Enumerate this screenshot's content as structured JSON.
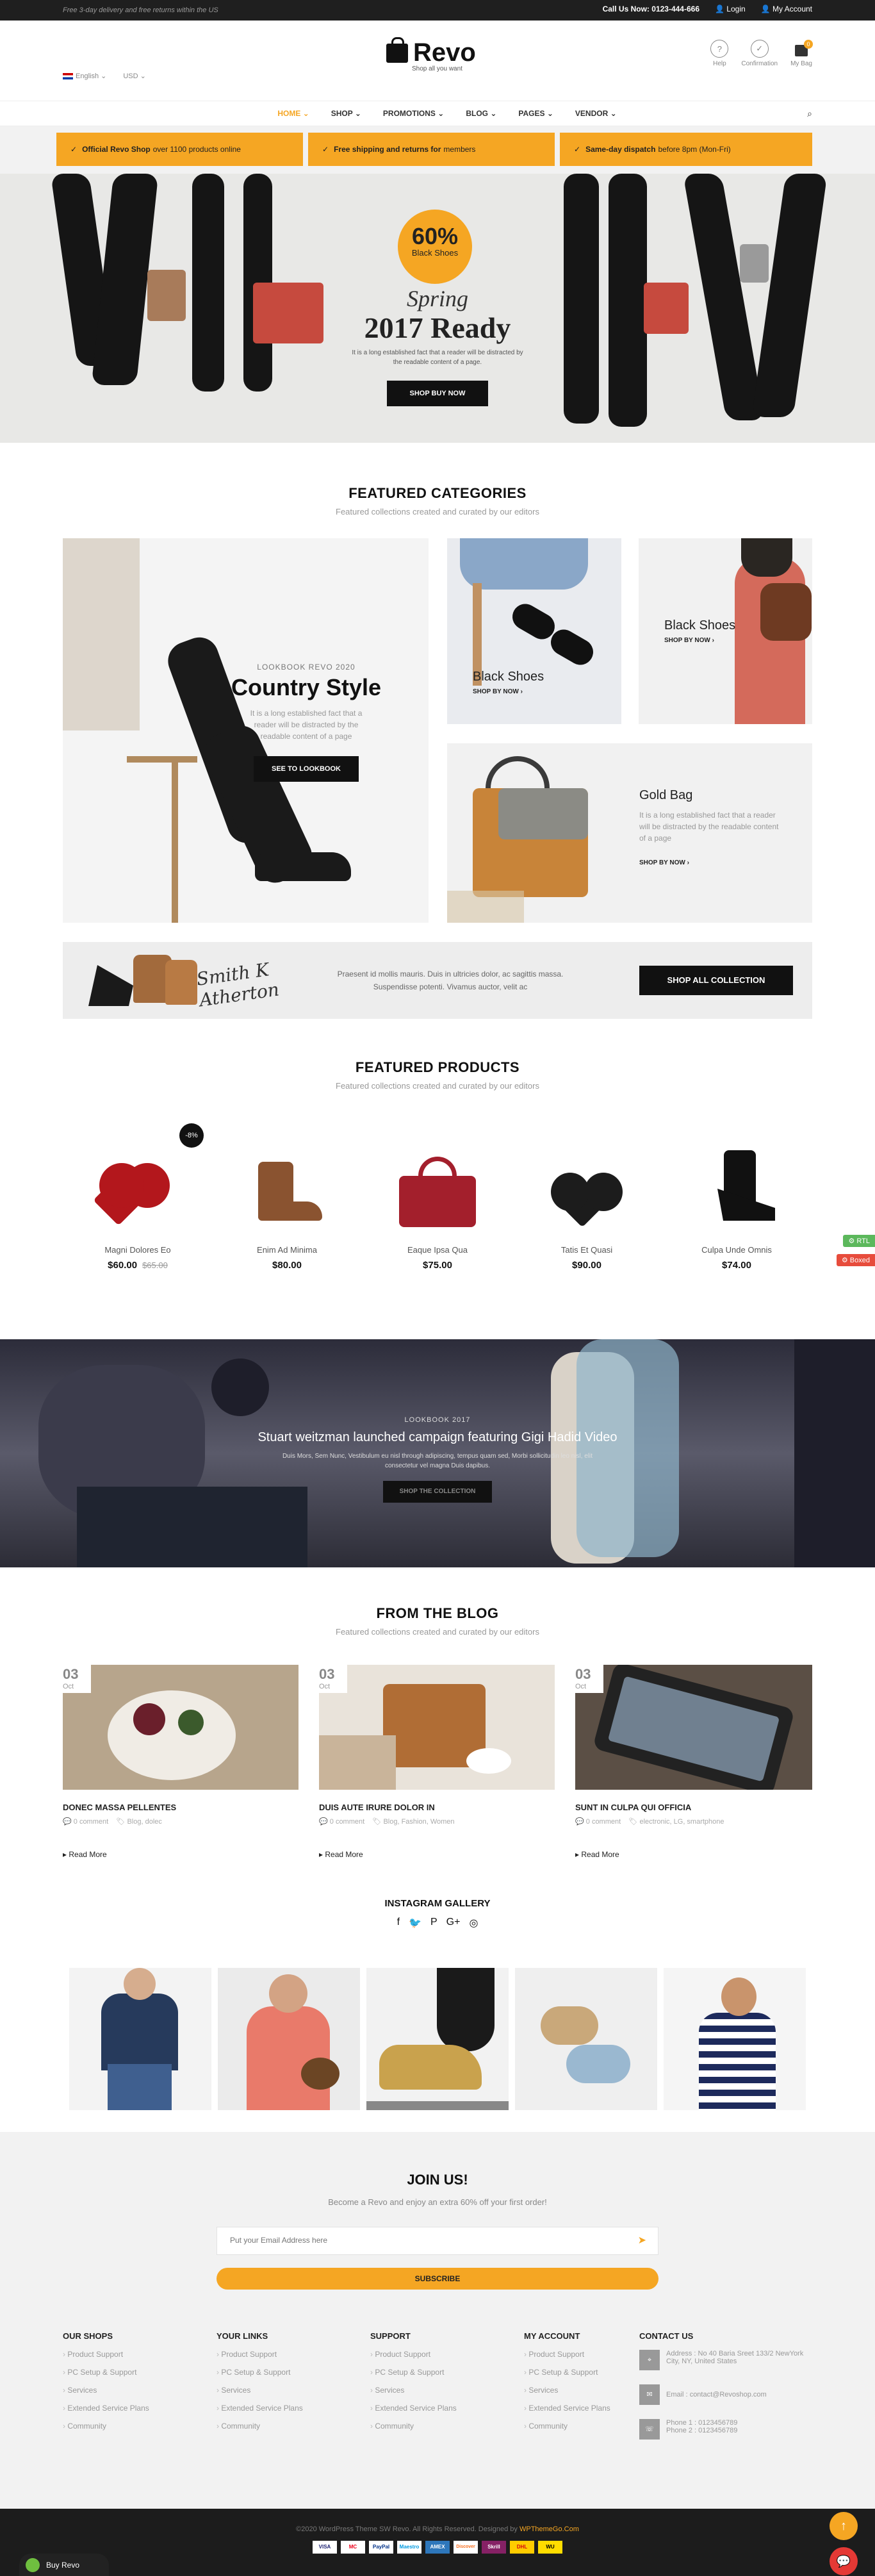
{
  "topbar": {
    "left_text": "Free 3-day delivery and free returns within the US",
    "call_label": "Call Us Now:",
    "call_number": "0123-444-666",
    "login": "Login",
    "my_account": "My Account"
  },
  "header": {
    "language": "English",
    "currency": "USD",
    "logo_name": "Revo",
    "logo_tagline": "Shop all you want",
    "icons": [
      {
        "label": "Help",
        "icon": "question-icon"
      },
      {
        "label": "Confirmation",
        "icon": "check-circle-icon"
      },
      {
        "label": "My Bag",
        "icon": "bag-icon",
        "count": "0"
      }
    ]
  },
  "nav": {
    "items": [
      "HOME",
      "SHOP",
      "PROMOTIONS",
      "BLOG",
      "PAGES",
      "VENDOR"
    ],
    "active": "HOME"
  },
  "promo": [
    {
      "bold": "Official Revo Shop",
      "rest": "over 1100 products online"
    },
    {
      "bold": "Free shipping and returns for",
      "rest": "members"
    },
    {
      "bold": "Same-day dispatch",
      "rest": "before 8pm (Mon-Fri)"
    }
  ],
  "hero": {
    "badge_percent": "60%",
    "badge_sub": "Black Shoes",
    "title_script": "Spring",
    "title_main": "2017 Ready",
    "desc": "It is a long established fact that a reader will be distracted by the readable content of a page.",
    "button": "SHOP BUY NOW"
  },
  "featured_categories": {
    "title": "FEATURED CATEGORIES",
    "subtitle": "Featured collections created and curated by our editors",
    "lookbook_kicker": "LOOKBOOK REVO 2020",
    "lookbook_title": "Country Style",
    "lookbook_desc": "It is a long established fact that a reader will be distracted by the readable content of a page",
    "lookbook_button": "SEE TO LOOKBOOK",
    "cards": [
      {
        "title": "Black Shoes",
        "link": "SHOP BY NOW"
      },
      {
        "title": "Black Shoes",
        "link": "SHOP BY NOW"
      },
      {
        "title": "Gold Bag",
        "desc": "It is a long established fact that a reader will be distracted by the readable content of a page",
        "link": "SHOP BY NOW"
      }
    ]
  },
  "collection_banner": {
    "text": "Praesent id mollis mauris. Duis in ultricies dolor, ac sagittis massa. Suspendisse potenti. Vivamus auctor, velit ac",
    "button": "SHOP ALL COLLECTION",
    "signature": "Smith K Atherton"
  },
  "featured_products": {
    "title": "FEATURED PRODUCTS",
    "subtitle": "Featured collections created and curated by our editors",
    "items": [
      {
        "name": "Magni Dolores Eo",
        "price": "$60.00",
        "old_price": "$65.00",
        "badge": "-8%"
      },
      {
        "name": "Enim Ad Minima",
        "price": "$80.00"
      },
      {
        "name": "Eaque Ipsa Qua",
        "price": "$75.00"
      },
      {
        "name": "Tatis Et Quasi",
        "price": "$90.00"
      },
      {
        "name": "Culpa Unde Omnis",
        "price": "$74.00"
      }
    ]
  },
  "video": {
    "kicker": "LOOKBOOK 2017",
    "title": "Stuart weitzman launched campaign featuring Gigi Hadid Video",
    "desc": "Duis Mors, Sem Nunc, Vestibulum eu nisl through adipiscing, tempus quam sed, Morbi sollicitudin leo nisl, elit consectetur vel magna Duis dapibus.",
    "button": "SHOP THE COLLECTION"
  },
  "side_buttons": {
    "rtl": "RTL",
    "boxed": "Boxed"
  },
  "blog": {
    "title": "FROM THE BLOG",
    "subtitle": "Featured collections created and curated by our editors",
    "posts": [
      {
        "day": "03",
        "month": "Oct",
        "title": "DONEC MASSA PELLENTES",
        "comments": "0 comment",
        "tags": "Blog, dolec",
        "read_more": "Read More"
      },
      {
        "day": "03",
        "month": "Oct",
        "title": "DUIS AUTE IRURE DOLOR IN",
        "comments": "0 comment",
        "tags": "Blog, Fashion, Women",
        "read_more": "Read More"
      },
      {
        "day": "03",
        "month": "Oct",
        "title": "SUNT IN CULPA QUI OFFICIA",
        "comments": "0 comment",
        "tags": "electronic, LG, smartphone",
        "read_more": "Read More"
      }
    ]
  },
  "instagram": {
    "title": "INSTAGRAM GALLERY",
    "socials": [
      "facebook-icon",
      "twitter-icon",
      "pinterest-icon",
      "google-plus-icon",
      "instagram-icon"
    ],
    "social_glyphs": [
      "f",
      "🐦",
      "P",
      "G+",
      "◎"
    ]
  },
  "join": {
    "title": "JOIN US!",
    "subtitle": "Become a Revo and enjoy an extra 60% off your first order!",
    "placeholder": "Put your Email Address here",
    "button": "SUBSCRIBE"
  },
  "footer": {
    "columns": [
      {
        "title": "OUR SHOPS",
        "items": [
          "Product Support",
          "PC Setup & Support",
          "Services",
          "Extended Service Plans",
          "Community"
        ]
      },
      {
        "title": "YOUR LINKS",
        "items": [
          "Product Support",
          "PC Setup & Support",
          "Services",
          "Extended Service Plans",
          "Community"
        ]
      },
      {
        "title": "SUPPORT",
        "items": [
          "Product Support",
          "PC Setup & Support",
          "Services",
          "Extended Service Plans",
          "Community"
        ]
      },
      {
        "title": "MY ACCOUNT",
        "items": [
          "Product Support",
          "PC Setup & Support",
          "Services",
          "Extended Service Plans",
          "Community"
        ]
      }
    ],
    "contact": {
      "title": "CONTACT US",
      "address_label": "Address :",
      "address": "No 40 Baria Sreet 133/2 NewYork City, NY, United States",
      "email_label": "Email :",
      "email": "contact@Revoshop.com",
      "phone1": "Phone 1 : 0123456789",
      "phone2": "Phone 2 : 0123456789"
    },
    "copyright": "©2020 WordPress Theme SW Revo. All Rights Reserved. Designed by",
    "designer": "WPThemeGo.Com",
    "payments": [
      "VISA",
      "MC",
      "PayPal",
      "Maestro",
      "AMEX",
      "Discover",
      "Skrill",
      "DHL",
      "WU"
    ]
  },
  "buy_button": "Buy Revo",
  "colors": {
    "accent": "#f5a623",
    "dark": "#1c1c1c"
  }
}
